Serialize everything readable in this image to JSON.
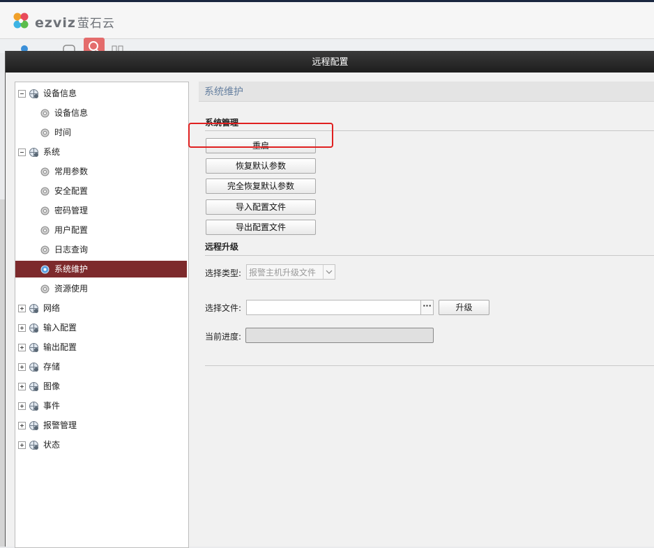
{
  "app": {
    "brand": "EZVIZ",
    "brand_cn": "萤石云"
  },
  "dialog": {
    "title": "远程配置"
  },
  "tree": [
    {
      "label": "设备信息",
      "level": 0,
      "expanded": true
    },
    {
      "label": "设备信息",
      "level": 1
    },
    {
      "label": "时间",
      "level": 1
    },
    {
      "label": "系统",
      "level": 0,
      "expanded": true
    },
    {
      "label": "常用参数",
      "level": 1
    },
    {
      "label": "安全配置",
      "level": 1
    },
    {
      "label": "密码管理",
      "level": 1
    },
    {
      "label": "用户配置",
      "level": 1
    },
    {
      "label": "日志查询",
      "level": 1
    },
    {
      "label": "系统维护",
      "level": 1,
      "selected": true
    },
    {
      "label": "资源使用",
      "level": 1
    },
    {
      "label": "网络",
      "level": 0,
      "expanded": false
    },
    {
      "label": "输入配置",
      "level": 0,
      "expanded": false
    },
    {
      "label": "输出配置",
      "level": 0,
      "expanded": false
    },
    {
      "label": "存储",
      "level": 0,
      "expanded": false
    },
    {
      "label": "图像",
      "level": 0,
      "expanded": false
    },
    {
      "label": "事件",
      "level": 0,
      "expanded": false
    },
    {
      "label": "报警管理",
      "level": 0,
      "expanded": false
    },
    {
      "label": "状态",
      "level": 0,
      "expanded": false
    }
  ],
  "content": {
    "section_title": "系统维护",
    "system_management": {
      "heading": "系统管理",
      "buttons": [
        "重启",
        "恢复默认参数",
        "完全恢复默认参数",
        "导入配置文件",
        "导出配置文件"
      ]
    },
    "remote_upgrade": {
      "heading": "远程升级",
      "type_label": "选择类型:",
      "type_value": "报警主机升级文件",
      "file_label": "选择文件:",
      "file_value": "",
      "browse_label": "···",
      "upgrade_button": "升级",
      "progress_label": "当前进度:",
      "progress": 0
    }
  },
  "colors": {
    "selected_bg": "#7d2a2c",
    "highlight_box": "#e02020",
    "titlebar": "#262626"
  }
}
